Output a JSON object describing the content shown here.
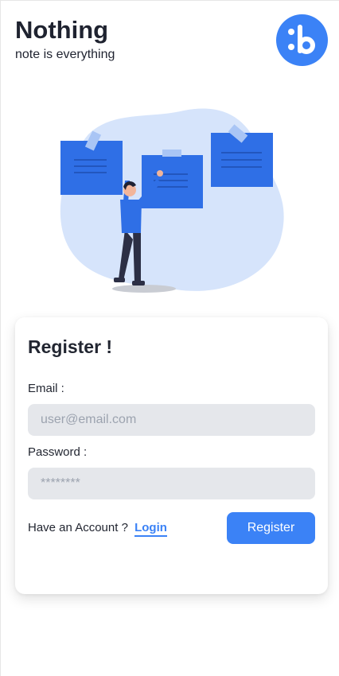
{
  "app": {
    "title": "Nothing",
    "subtitle": "note is everything"
  },
  "register": {
    "title": "Register !",
    "email_label": "Email :",
    "email_placeholder": "user@email.com",
    "password_label": "Password :",
    "password_placeholder": "********",
    "have_account_text": "Have an Account ?",
    "login_link": "Login",
    "register_button": "Register"
  },
  "colors": {
    "accent": "#3b82f6",
    "text": "#222631",
    "input_bg": "#e5e7eb"
  }
}
